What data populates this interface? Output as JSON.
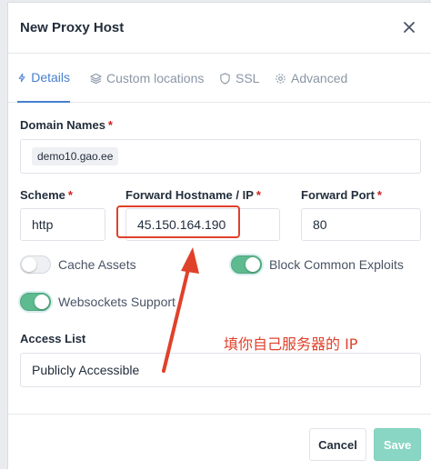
{
  "modal": {
    "title": "New Proxy Host"
  },
  "tabs": [
    {
      "label": "Details",
      "icon": "bolt-icon",
      "active": true
    },
    {
      "label": "Custom locations",
      "icon": "layers-icon",
      "active": false
    },
    {
      "label": "SSL",
      "icon": "shield-icon",
      "active": false
    },
    {
      "label": "Advanced",
      "icon": "gear-icon",
      "active": false
    }
  ],
  "form": {
    "domain_names": {
      "label": "Domain Names",
      "required_mark": "*",
      "value": "demo10.gao.ee"
    },
    "scheme": {
      "label": "Scheme",
      "required_mark": "*",
      "value": "http"
    },
    "forward_host": {
      "label": "Forward Hostname / IP",
      "required_mark": "*",
      "value": "45.150.164.190"
    },
    "forward_port": {
      "label": "Forward Port",
      "required_mark": "*",
      "value": "80"
    },
    "cache_assets": {
      "label": "Cache Assets",
      "enabled": false
    },
    "block_exploits": {
      "label": "Block Common Exploits",
      "enabled": true
    },
    "websockets": {
      "label": "Websockets Support",
      "enabled": true
    },
    "access_list": {
      "label": "Access List",
      "value": "Publicly Accessible"
    }
  },
  "annotation": {
    "text": "填你自己服务器的 IP",
    "color": "#e0412b"
  },
  "footer": {
    "cancel_label": "Cancel",
    "save_label": "Save"
  },
  "colors": {
    "accent": "#467fcf",
    "toggle_on": "#5eba8f",
    "save_button": "#88d6c3"
  }
}
